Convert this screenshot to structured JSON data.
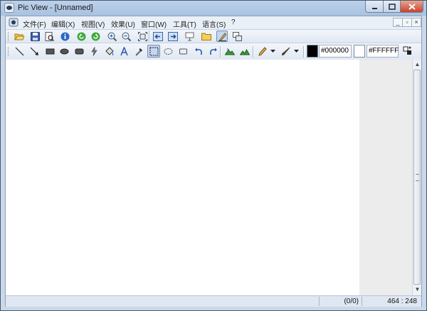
{
  "window": {
    "title": "Pic View - [Unnamed]"
  },
  "menu": {
    "items": [
      {
        "label": "文件(F)"
      },
      {
        "label": "编辑(X)"
      },
      {
        "label": "视图(V)"
      },
      {
        "label": "效果(U)"
      },
      {
        "label": "窗口(W)"
      },
      {
        "label": "工具(T)"
      },
      {
        "label": "语言(S)"
      },
      {
        "label": "?"
      }
    ]
  },
  "toolbar1": {
    "buttons": [
      "open-icon",
      "save-icon",
      "print-preview-icon",
      "info-icon",
      "rotate-left-icon",
      "rotate-right-icon",
      "zoom-in-icon",
      "zoom-out-icon",
      "fit-size-icon",
      "previous-icon",
      "next-icon",
      "slideshow-icon",
      "folder-icon",
      "edit-mode-icon",
      "copy-window-icon"
    ]
  },
  "toolbar2": {
    "tools": [
      "line-icon",
      "arrow-icon",
      "filled-rectangle-icon",
      "filled-ellipse-icon",
      "rounded-rectangle-icon",
      "lightning-icon",
      "fill-bucket-icon",
      "text-icon",
      "eyedropper-icon",
      "rect-select-icon",
      "ellipse-select-icon",
      "rectangle-outline-icon",
      "undo-icon",
      "redo-icon",
      "mountain-icon-1",
      "mountain-icon-2",
      "pencil-icon",
      "brush-icon"
    ],
    "foreground_color": "#000000",
    "background_color": "#FFFFFF",
    "fg_hex": "#000000",
    "bg_hex": "#FFFFFF"
  },
  "status": {
    "index": "(0/0)",
    "coords": "464 : 248"
  },
  "colors": {
    "titlebar": "#a8c2e0",
    "close_button": "#c7432e",
    "canvas": "#ffffff"
  }
}
